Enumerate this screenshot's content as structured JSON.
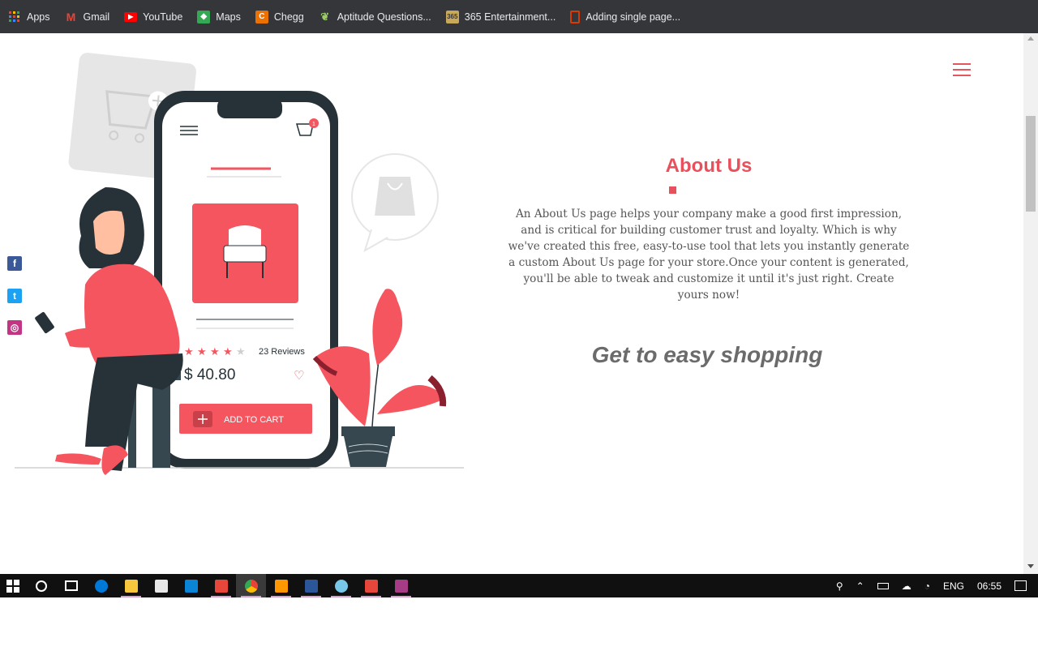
{
  "bookmarks": [
    {
      "label": "Apps",
      "icon": "apps-grid-icon",
      "color": "#e8eaed"
    },
    {
      "label": "Gmail",
      "icon": "gmail-icon",
      "color": "#ea4335"
    },
    {
      "label": "YouTube",
      "icon": "youtube-icon",
      "color": "#ff0000"
    },
    {
      "label": "Maps",
      "icon": "maps-icon",
      "color": "#34a853"
    },
    {
      "label": "Chegg",
      "icon": "chegg-icon",
      "color": "#eb7100"
    },
    {
      "label": "Aptitude Questions...",
      "icon": "leaf-icon",
      "color": "#7cb342"
    },
    {
      "label": "365 Entertainment...",
      "icon": "365-icon",
      "color": "#c8a85b"
    },
    {
      "label": "Adding single page...",
      "icon": "office-icon",
      "color": "#d83b01"
    }
  ],
  "illustration": {
    "reviews": "23 Reviews",
    "price": "$ 40.80",
    "add_to_cart": "ADD TO CART",
    "cart_badge": "1"
  },
  "about": {
    "title": "About Us",
    "text": "An About Us page helps your company make a good first impression, and is critical for building customer trust and loyalty. Which is why we've created this free, easy-to-use tool that lets you instantly generate a custom About Us page for your store.Once your content is generated, you'll be able to tweak and customize it until it's just right. Create yours now!",
    "tagline": "Get to easy shopping"
  },
  "social": [
    {
      "name": "facebook",
      "glyph": "f",
      "color": "#3b5998"
    },
    {
      "name": "twitter",
      "glyph": "t",
      "color": "#1da1f2"
    },
    {
      "name": "instagram",
      "glyph": "◎",
      "color": "#c13584"
    }
  ],
  "colors": {
    "accent": "#e8505b",
    "bookmark_bar": "#35363a",
    "taskbar": "#101010"
  },
  "taskbar": {
    "apps": [
      {
        "name": "cortana",
        "icon": "circle-icon"
      },
      {
        "name": "task-view",
        "icon": "task-view-icon"
      },
      {
        "name": "edge",
        "icon": "edge-icon",
        "color": "#0078d7"
      },
      {
        "name": "file-explorer",
        "icon": "folder-icon",
        "color": "#f8c63d"
      },
      {
        "name": "store",
        "icon": "store-icon",
        "color": "#e8e8e8"
      },
      {
        "name": "mail",
        "icon": "mail-icon",
        "color": "#0a84d6"
      },
      {
        "name": "app-red",
        "icon": "red-app-icon",
        "color": "#e7473b"
      },
      {
        "name": "chrome",
        "icon": "chrome-icon",
        "color": "#4caf50"
      },
      {
        "name": "sublime",
        "icon": "sublime-icon",
        "color": "#ff9800"
      },
      {
        "name": "word",
        "icon": "word-icon",
        "color": "#2b579a"
      },
      {
        "name": "paint",
        "icon": "paint-icon",
        "color": "#77c7e8"
      },
      {
        "name": "app-red-2",
        "icon": "red-app-2-icon",
        "color": "#e7473b"
      },
      {
        "name": "winrar",
        "icon": "winrar-icon",
        "color": "#a63b86"
      }
    ],
    "language": "ENG",
    "time": "06:55"
  }
}
